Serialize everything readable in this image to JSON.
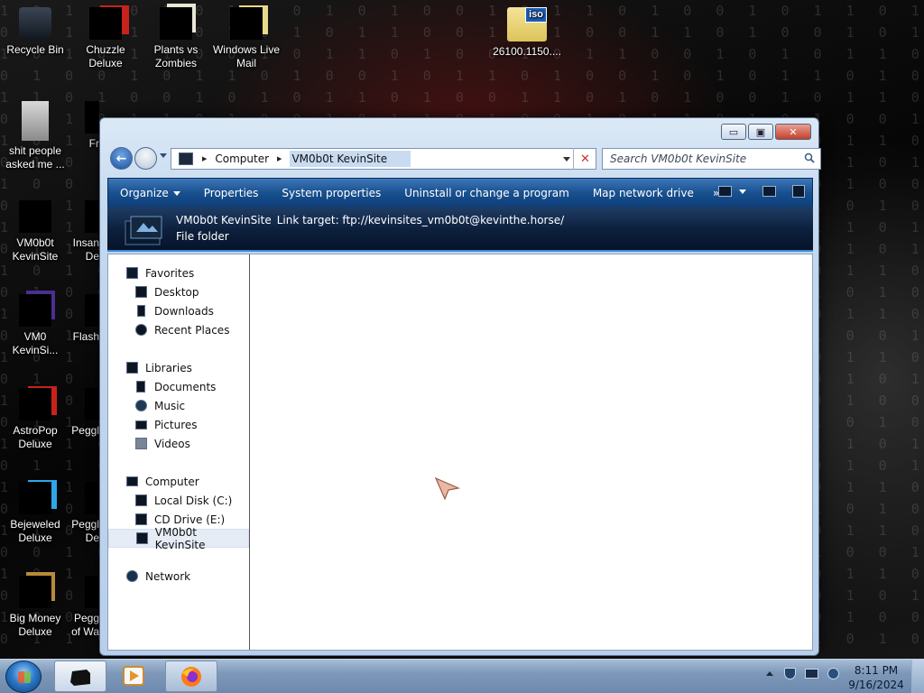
{
  "desktop": {
    "icons": [
      {
        "id": "recycle-bin",
        "label": "Recycle Bin"
      },
      {
        "id": "chuzzle-deluxe",
        "label": "Chuzzle Deluxe"
      },
      {
        "id": "plants-vs-zombies",
        "label": "Plants vs Zombies"
      },
      {
        "id": "windows-live-mail",
        "label": "Windows Live Mail"
      },
      {
        "id": "iso-file",
        "label": "26100.1150...."
      },
      {
        "id": "shit-people",
        "label": "shit people asked me ..."
      },
      {
        "id": "fr-partial",
        "label": "Fr"
      },
      {
        "id": "vm0b0t-kevinsite",
        "label": "VM0b0t KevinSite"
      },
      {
        "id": "insan-partial",
        "label": "Insan De"
      },
      {
        "id": "vm0-kevinsi",
        "label": "VM0 KevinSi..."
      },
      {
        "id": "flash-partial",
        "label": "Flash"
      },
      {
        "id": "astropop-deluxe",
        "label": "AstroPop Deluxe"
      },
      {
        "id": "peggle-partial-1",
        "label": "Peggl"
      },
      {
        "id": "bejeweled-deluxe",
        "label": "Bejeweled Deluxe"
      },
      {
        "id": "peggle-partial-2",
        "label": "Peggl De"
      },
      {
        "id": "big-money-deluxe",
        "label": "Big Money Deluxe"
      },
      {
        "id": "peggle-of-war-partial",
        "label": "Pegg of Wa"
      }
    ],
    "iso_badge": "iso"
  },
  "window": {
    "caption_buttons": {
      "minimize": "▭",
      "maximize": "▣",
      "close": "✕"
    },
    "address": {
      "crumbs": [
        "Computer",
        "VM0b0t KevinSite"
      ]
    },
    "search": {
      "placeholder": "Search VM0b0t KevinSite"
    },
    "toolbar": {
      "organize": "Organize",
      "properties": "Properties",
      "system_properties": "System properties",
      "uninstall": "Uninstall or change a program",
      "map_drive": "Map network drive",
      "more": "»"
    },
    "details": {
      "name": "VM0b0t KevinSite",
      "link_target": "Link target: ftp://kevinsites_vm0b0t@kevinthe.horse/",
      "type": "File folder"
    },
    "nav_pane": {
      "favorites": "Favorites",
      "favorites_items": [
        "Desktop",
        "Downloads",
        "Recent Places"
      ],
      "libraries": "Libraries",
      "libraries_items": [
        "Documents",
        "Music",
        "Pictures",
        "Videos"
      ],
      "computer": "Computer",
      "computer_items": [
        "Local Disk (C:)",
        "CD Drive (E:)",
        "VM0b0t KevinSite"
      ],
      "network": "Network"
    }
  },
  "taskbar": {
    "clock_time": "8:11 PM",
    "clock_date": "9/16/2024"
  }
}
